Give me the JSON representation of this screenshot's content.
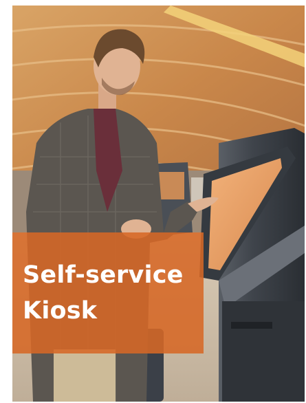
{
  "caption": {
    "line1": "Self-service",
    "line2": "Kiosk"
  },
  "colors": {
    "caption_background": "#d66826",
    "caption_text": "#ffffff",
    "page_background": "#ffffff"
  }
}
